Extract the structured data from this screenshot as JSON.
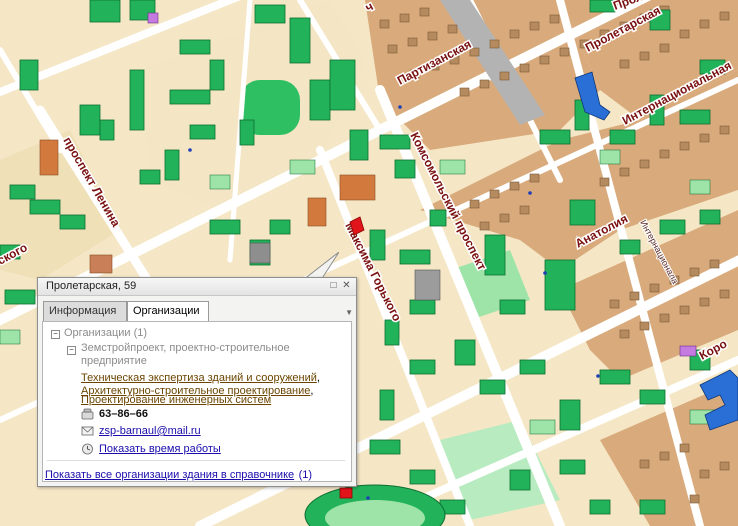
{
  "map": {
    "streets": {
      "partizanskaya": "Партизанская",
      "proletarskaya": "Пролетарская",
      "internatsionalnaya": "Интернациональная",
      "komsomolsky": "Комсомольский проспект",
      "lenina": "проспект Ленина",
      "gorkogo": "Максима Горького",
      "anatolia": "Анатолия",
      "partial_left": "ского",
      "partial_top": "ч",
      "partial_top_right": "Пролета",
      "partial_right": "Коро",
      "small_label": "Интернационала"
    },
    "colors": {
      "building": "#22b35a",
      "building_light": "#9ee4a8",
      "block": "#f4e6c4",
      "block_brown": "#d9aa7b",
      "road": "#ffffff",
      "label": "#7a1010",
      "marker": "#e0141a",
      "blue_building": "#2a6fd6",
      "purple_building": "#c47adf"
    }
  },
  "popup": {
    "title": "Пролетарская, 59",
    "tabs": [
      "Информация",
      "Организации"
    ],
    "active_tab": "Организации",
    "orgs_header": "Организации (1)",
    "org_name_line1": "Земстройпроект, проектно-строительное",
    "org_name_line2": "предприятие",
    "categories": [
      "Техническая экспертиза зданий и сооружений",
      "Архитектурно-строительное проектирование",
      "Проектирование инженерных систем"
    ],
    "phone": "63–86–66",
    "email": "zsp-barnaul@mail.ru",
    "hours_link": "Показать время работы",
    "footer_link": "Показать все организации здания в справочнике",
    "footer_count": "(1)"
  }
}
